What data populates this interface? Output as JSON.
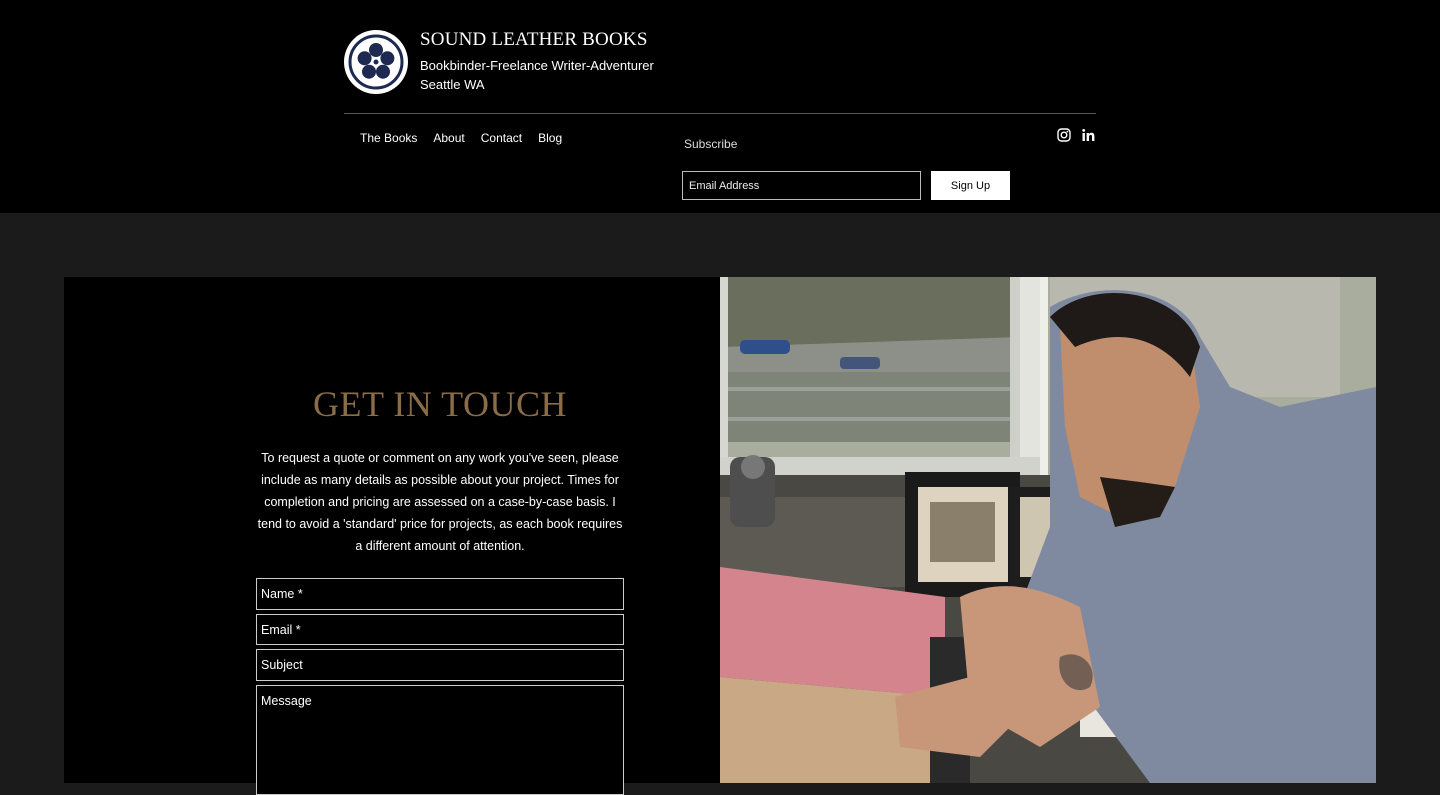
{
  "brand": {
    "title": "SOUND LEATHER BOOKS",
    "subtitle": "Bookbinder-Freelance Writer-Adventurer",
    "location": "Seattle WA"
  },
  "nav": {
    "items": [
      {
        "label": "The Books"
      },
      {
        "label": "About"
      },
      {
        "label": "Contact"
      },
      {
        "label": "Blog"
      }
    ]
  },
  "subscribe": {
    "label": "Subscribe",
    "email_placeholder": "Email Address",
    "button_label": "Sign Up"
  },
  "social": [
    "instagram-icon",
    "linkedin-icon"
  ],
  "contact": {
    "title": "GET IN TOUCH",
    "text": "To request a quote or comment on any work you've seen, please include as many details as possible about your project.  Times for completion and pricing are assessed on a case-by-case basis.  I tend to avoid a 'standard' price for projects, as each book requires a different amount of attention.",
    "fields": {
      "name_placeholder": "Name *",
      "email_placeholder": "Email *",
      "subject_placeholder": "Subject",
      "message_placeholder": "Message"
    }
  },
  "colors": {
    "header_bg": "#000000",
    "page_bg": "#1b1b1b",
    "accent_title": "#8a6d48"
  }
}
